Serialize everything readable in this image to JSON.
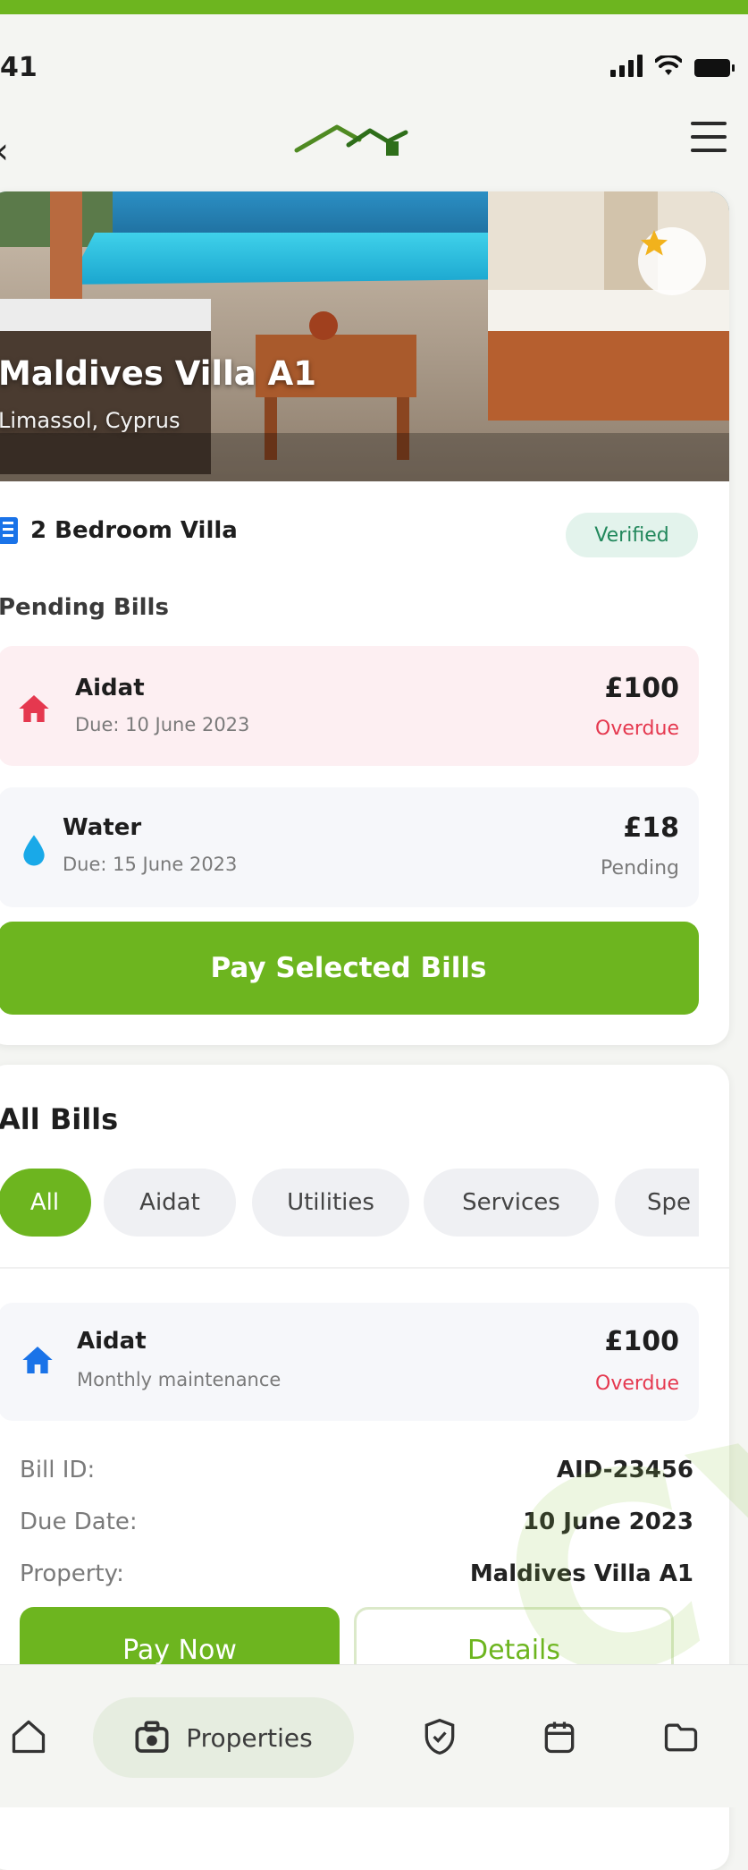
{
  "status_bar": {
    "time": "41"
  },
  "property": {
    "name": "Maldives Villa A1",
    "location": "Limassol, Cyprus",
    "type": "2 Bedroom Villa",
    "badge": "Verified"
  },
  "pending_bills": {
    "title": "Pending Bills",
    "items": [
      {
        "title": "Aidat",
        "due": "Due: 10 June 2023",
        "amount": "£100",
        "status": "Overdue"
      },
      {
        "title": "Water",
        "due": "Due: 15 June 2023",
        "amount": "£18",
        "status": "Pending"
      }
    ],
    "pay_button": "Pay Selected Bills"
  },
  "all_bills": {
    "title": "All Bills",
    "filters": [
      "All",
      "Aidat",
      "Utilities",
      "Services",
      "Spe"
    ],
    "active_filter": "All",
    "bill": {
      "title": "Aidat",
      "subtitle": "Monthly maintenance",
      "amount": "£100",
      "status": "Overdue",
      "details": [
        {
          "label": "Bill ID:",
          "value": "AID-23456"
        },
        {
          "label": "Due Date:",
          "value": "10 June 2023"
        },
        {
          "label": "Property:",
          "value": "Maldives Villa A1"
        }
      ],
      "pay_now": "Pay Now",
      "details_button": "Details"
    }
  },
  "watermark": "CYP",
  "bottom_nav": {
    "active_label": "Properties",
    "icons": [
      "home-icon",
      "properties-icon",
      "shield-icon",
      "calendar-icon",
      "folder-icon"
    ]
  },
  "colors": {
    "brand_green": "#6db51f",
    "overdue_red": "#e5384f",
    "verified_green": "#22885c",
    "icon_blue": "#1a73e8"
  }
}
